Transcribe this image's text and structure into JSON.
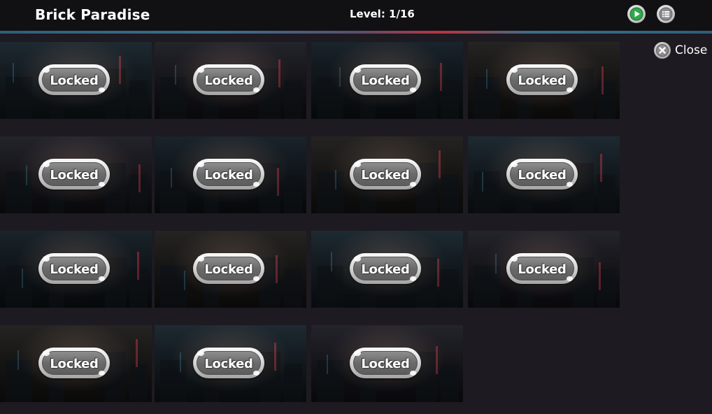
{
  "header": {
    "title": "Brick Paradise",
    "level_text": "Level: 1/16"
  },
  "controls": {
    "play_icon": "play-icon",
    "menu_icon": "list-icon",
    "close_label": "Close",
    "close_icon": "close-icon"
  },
  "gallery": {
    "lock_label": "Locked",
    "item_count": 15
  },
  "colors": {
    "background": "#1d1a21",
    "topbar": "#111013",
    "accent_strip_blue": "#3a6f8c",
    "accent_strip_red": "#b8353f",
    "play_green": "#2fa84a"
  }
}
